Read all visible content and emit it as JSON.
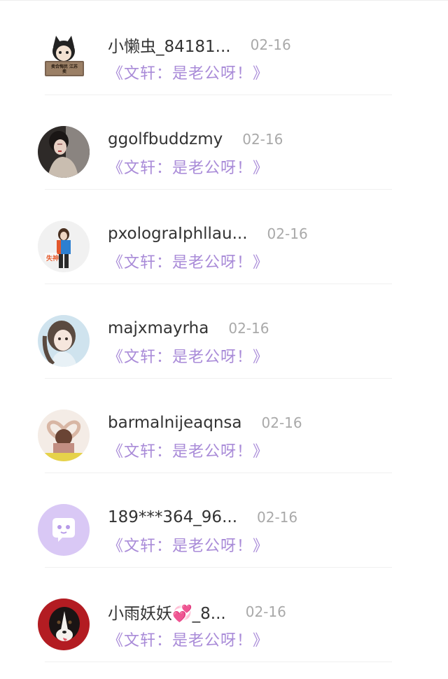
{
  "comments": [
    {
      "username": "小懒虫_84181...",
      "date": "02-16",
      "text": "《文轩：是老公呀！》",
      "avatar": "cat-ears-sign-avatar",
      "avatar_text": "卖合悔民 江苏卖"
    },
    {
      "username": "ggolfbuddzmy",
      "date": "02-16",
      "text": "《文轩：是老公呀！》",
      "avatar": "woman-portrait-avatar"
    },
    {
      "username": "pxolograIphllau...",
      "date": "02-16",
      "text": "《文轩：是老公呀！》",
      "avatar": "standing-person-avatar",
      "avatar_text": "失神"
    },
    {
      "username": "majxmayrha",
      "date": "02-16",
      "text": "《文轩：是老公呀！》",
      "avatar": "anime-girl-avatar"
    },
    {
      "username": "barmalnijeaqnsa",
      "date": "02-16",
      "text": "《文轩：是老公呀！》",
      "avatar": "heart-hands-avatar"
    },
    {
      "username": "189***364_96...",
      "date": "02-16",
      "text": "《文轩：是老公呀！》",
      "avatar": "default-chat-bubble-avatar"
    },
    {
      "username": "小雨妖妖💞_8...",
      "date": "02-16",
      "text": "《文轩：是老公呀！》",
      "avatar": "dog-avatar"
    }
  ],
  "colors": {
    "username": "#333333",
    "date": "#a9a9a9",
    "comment": "#a98bd8",
    "default_avatar_bg": "#d9c8f5"
  }
}
